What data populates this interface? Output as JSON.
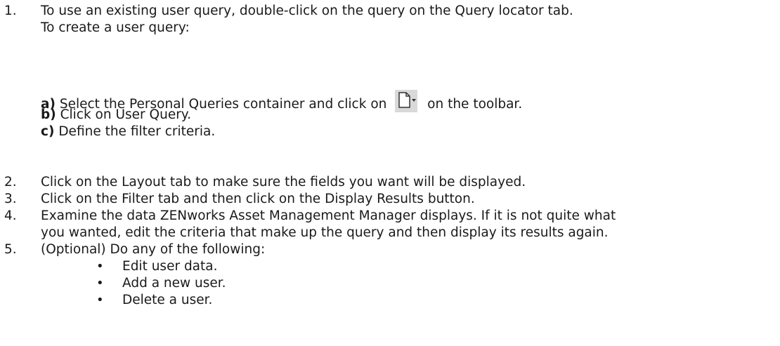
{
  "steps": [
    {
      "number": "1.",
      "lines": [
        "To use an existing user query, double-click on the query on the Query locator tab.",
        "To create a user query:"
      ],
      "substeps": [
        {
          "label": "a)",
          "text_before": "Select the Personal Queries container and click on",
          "icon": "new-document-dropdown-icon",
          "text_after": "on the toolbar."
        },
        {
          "label": "b)",
          "text": "Click on User Query."
        },
        {
          "label": "c)",
          "text": "Define the filter criteria."
        }
      ]
    },
    {
      "number": "2.",
      "lines": [
        "Click on the Layout tab to make sure the fields you want will be displayed."
      ]
    },
    {
      "number": "3.",
      "lines": [
        "Click on the Filter tab and then click on the Display Results button."
      ]
    },
    {
      "number": "4.",
      "lines": [
        "Examine the data ZENworks Asset Management Manager displays. If it is not quite what",
        "you wanted, edit the criteria that make up the query and then display its results again."
      ]
    },
    {
      "number": "5.",
      "lines": [
        "(Optional) Do any of the following:"
      ],
      "bullets": [
        "Edit user data.",
        "Add a new user.",
        "Delete a user."
      ]
    }
  ],
  "colors": {
    "text": "#1a1a1a",
    "icon_bg": "#d9d9d9"
  },
  "bullet_glyph": "•"
}
